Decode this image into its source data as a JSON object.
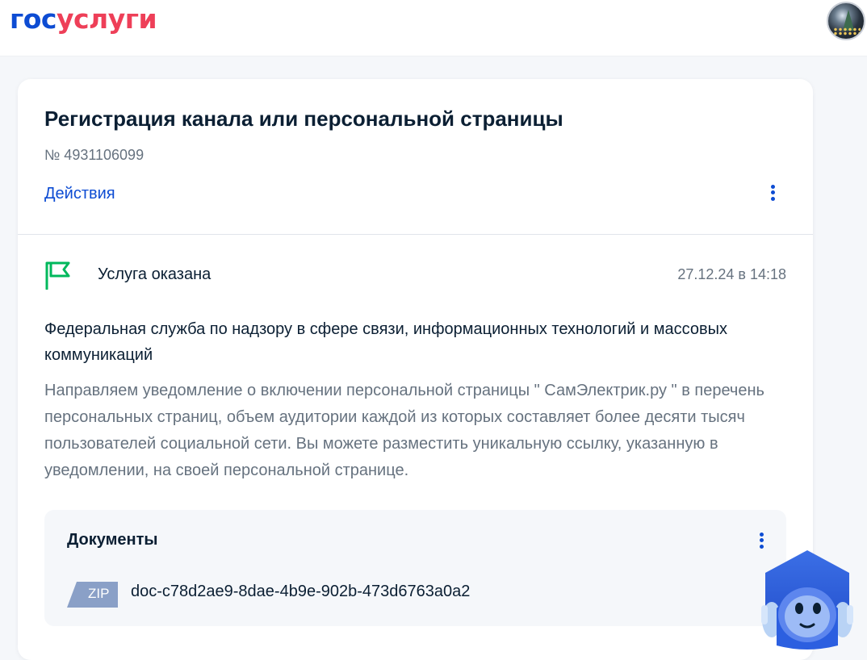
{
  "header": {
    "logo_part1": "гос",
    "logo_part2": "услуги",
    "avatar_icon": "user-avatar-photo"
  },
  "application": {
    "title": "Регистрация канала или персональной страницы",
    "number": "№ 4931106099",
    "actions_label": "Действия"
  },
  "status": {
    "icon": "flag-icon",
    "label": "Услуга оказана",
    "timestamp": "27.12.24 в 14:18"
  },
  "message": {
    "organization": "Федеральная служба по надзору в сфере связи, информационных технологий и массовых коммуникаций",
    "text": "Направляем уведомление о включении персональной страницы \" СамЭлектрик.ру \" в перечень персональных страниц, объем аудитории каждой из которых составляет более десяти тысяч пользователей социальной сети. Вы можете разместить уникальную ссылку, указанную в уведомлении, на своей персональной странице."
  },
  "documents": {
    "title": "Документы",
    "items": [
      {
        "type_label": "ZIP",
        "name": "doc-c78d2ae9-8dae-4b9e-902b-473d6763a0a2"
      }
    ]
  },
  "colors": {
    "brand_blue": "#0d4cd3",
    "brand_red": "#ee3f58",
    "status_green": "#00b85c",
    "zip_badge": "#8aa0c7"
  }
}
